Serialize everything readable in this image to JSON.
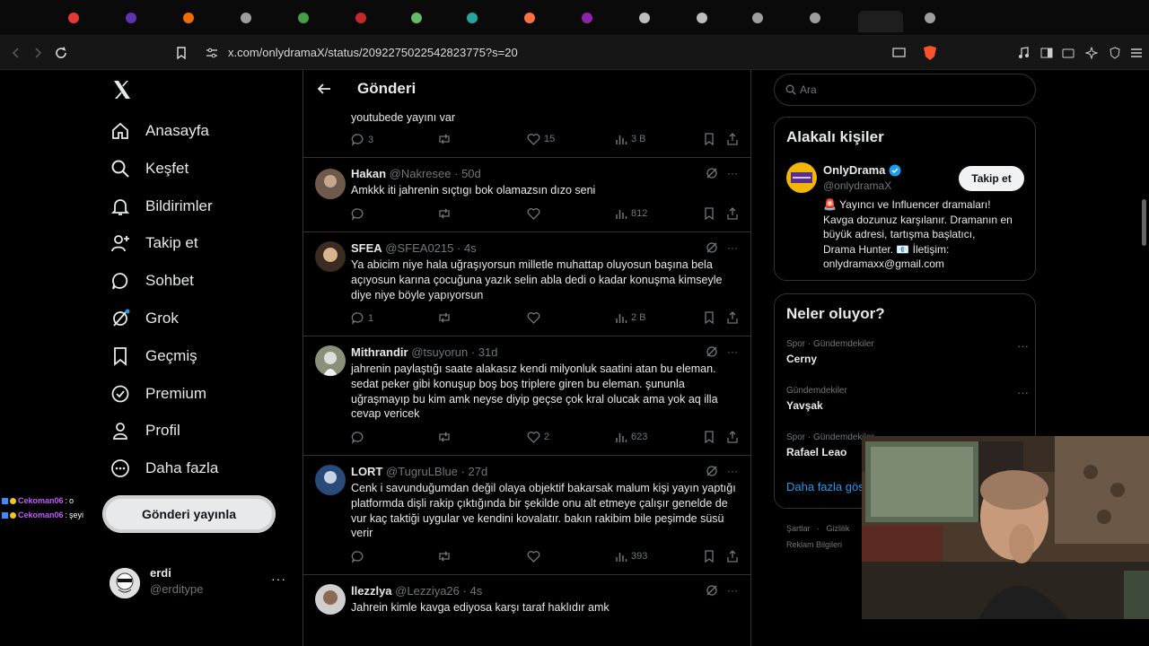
{
  "browser": {
    "url": "x.com/onlydramaX/status/209227502254282377​5?s=20"
  },
  "sidebar": {
    "items": [
      {
        "label": "Anasayfa",
        "icon": "home-icon"
      },
      {
        "label": "Keşfet",
        "icon": "search-icon"
      },
      {
        "label": "Bildirimler",
        "icon": "bell-icon"
      },
      {
        "label": "Takip et",
        "icon": "add-person-icon"
      },
      {
        "label": "Sohbet",
        "icon": "chat-icon"
      },
      {
        "label": "Grok",
        "icon": "grok-icon"
      },
      {
        "label": "Geçmiş",
        "icon": "bookmark-icon"
      },
      {
        "label": "Premium",
        "icon": "verified-icon"
      },
      {
        "label": "Profil",
        "icon": "person-icon"
      },
      {
        "label": "Daha fazla",
        "icon": "more-circle-icon"
      }
    ],
    "post_button": "Gönderi yayınla",
    "profile": {
      "name": "erdi",
      "handle": "@erditype"
    }
  },
  "chat_overlay": [
    {
      "user": "Cekoman06",
      "msg": "o"
    },
    {
      "user": "Cekoman06",
      "msg": "şeyi"
    }
  ],
  "feed": {
    "title": "Gönderi",
    "tweets": [
      {
        "name": "",
        "handle": "",
        "time": "",
        "text": "youtubede yayını var",
        "replies": "3",
        "retweets": "",
        "likes": "15",
        "views": "3 B"
      },
      {
        "name": "Hakan",
        "handle": "@Nakresee",
        "time": "· 50d",
        "text": "Amkkk iti jahrenin sıçtıgı bok olamazsın dızo seni",
        "replies": "",
        "retweets": "",
        "likes": "",
        "views": "812"
      },
      {
        "name": "SFEA",
        "handle": "@SFEA0215",
        "time": "· 4s",
        "text": "Ya abicim niye hala uğraşıyorsun milletle muhattap oluyosun başına bela açıyosun karına çocuğuna yazık selin abla dedi o kadar konuşma kimseyle diye niye böyle yapıyorsun",
        "replies": "1",
        "retweets": "",
        "likes": "",
        "views": "2 B"
      },
      {
        "name": "Mithrandir",
        "handle": "@tsuyorun",
        "time": "· 31d",
        "text": "jahrenin paylaştığı saate alakasız kendi milyonluk saatini atan bu eleman. sedat peker gibi konuşup boş boş triplere giren bu eleman. şunun​la uğraşmayıp bu kim amk neyse diyip geçse çok kral olucak ama yok aq illa cevap vericek",
        "replies": "",
        "retweets": "",
        "likes": "2",
        "views": "623"
      },
      {
        "name": "LORT",
        "handle": "@TugruLBlue",
        "time": "· 27d",
        "text": "Cenk i savunduğumdan değil olaya objektif bakarsak malum kişi yayın yaptığı platformda dişli rakip çıktığında bir şekilde onu alt etmeye çalışır genelde de vur kaç taktiği uygular ve kendini kovalatır. bakın rakibim bile peşimde süsü verir",
        "replies": "",
        "retweets": "",
        "likes": "",
        "views": "393"
      },
      {
        "name": "llezzlya",
        "handle": "@Lezziya26",
        "time": "· 4s",
        "text": "Jahrein kimle kavga ediyosa karşı taraf haklıdır amk",
        "replies": "",
        "retweets": "",
        "likes": "",
        "views": ""
      }
    ]
  },
  "right": {
    "search_placeholder": "Ara",
    "related": {
      "title": "Alakalı kişiler",
      "name": "OnlyDrama",
      "handle": "@onlydramaX",
      "follow": "Takip et",
      "bio_line1": "🚨 Yayıncı ve Influencer dramaları!",
      "bio_line2": "Kavga dozunuz karşılanır. Dramanın en",
      "bio_line3": "büyük adresi, tartışma başlatıcı,",
      "bio_line4": "Drama Hunter. 📧 İletişim:",
      "bio_line5": "onlydramaxx@gmail.com"
    },
    "trends": {
      "title": "Neler oluyor?",
      "items": [
        {
          "category": "Spor · Gündemdekiler",
          "name": "Cerny"
        },
        {
          "category": "Gündemdekiler",
          "name": "Yavşak"
        },
        {
          "category": "Spor · Gündemdekiler",
          "name": "Rafael Leao"
        }
      ],
      "show_more": "Daha fazla gös"
    },
    "footer": {
      "links1": "Şartlar   ·   Gizlilik",
      "links2": "Reklam Bilgileri"
    }
  },
  "colors": {
    "bg": "#000000",
    "text": "#e7e9ea",
    "muted": "#71767b",
    "accent": "#1d9bf0",
    "border": "#2f3336"
  }
}
